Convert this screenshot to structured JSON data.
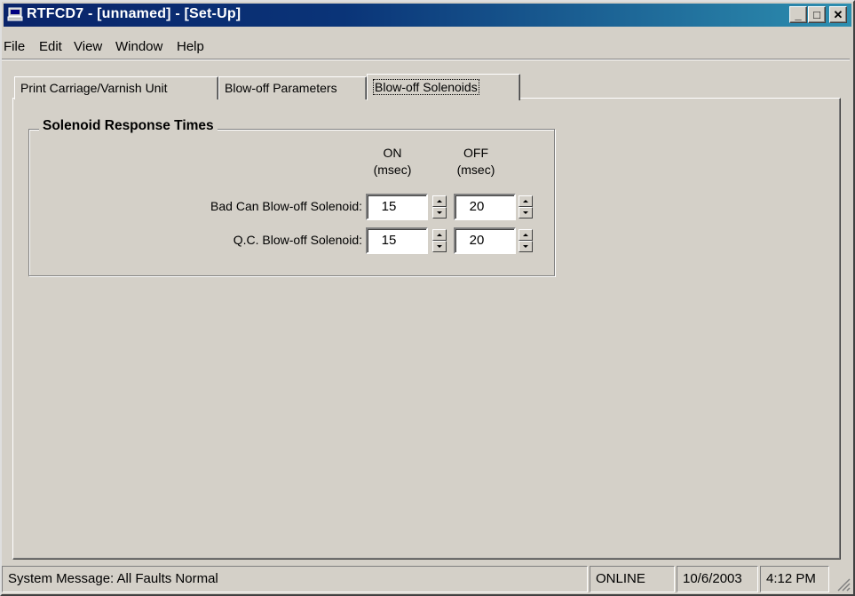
{
  "window": {
    "title": "RTFCD7 - [unnamed] - [Set-Up]",
    "icon": "computer-icon",
    "controls": {
      "minimize": "_",
      "maximize": "□",
      "close": "✕"
    }
  },
  "menu": [
    "File",
    "Edit",
    "View",
    "Window",
    "Help"
  ],
  "tabs": [
    {
      "label": "Print Carriage/Varnish Unit",
      "active": false
    },
    {
      "label": "Blow-off Parameters",
      "active": false
    },
    {
      "label": "Blow-off Solenoids",
      "active": true
    }
  ],
  "group": {
    "title": "Solenoid Response Times",
    "columns": [
      {
        "label": "ON",
        "unit": "(msec)"
      },
      {
        "label": "OFF",
        "unit": "(msec)"
      }
    ],
    "rows": [
      {
        "label": "Bad Can Blow-off Solenoid:",
        "on": "15",
        "off": "20"
      },
      {
        "label": "Q.C. Blow-off Solenoid:",
        "on": "15",
        "off": "20"
      }
    ]
  },
  "statusbar": {
    "message": "System Message:  All Faults Normal",
    "connection": "ONLINE",
    "date": "10/6/2003",
    "time": "4:12 PM"
  }
}
